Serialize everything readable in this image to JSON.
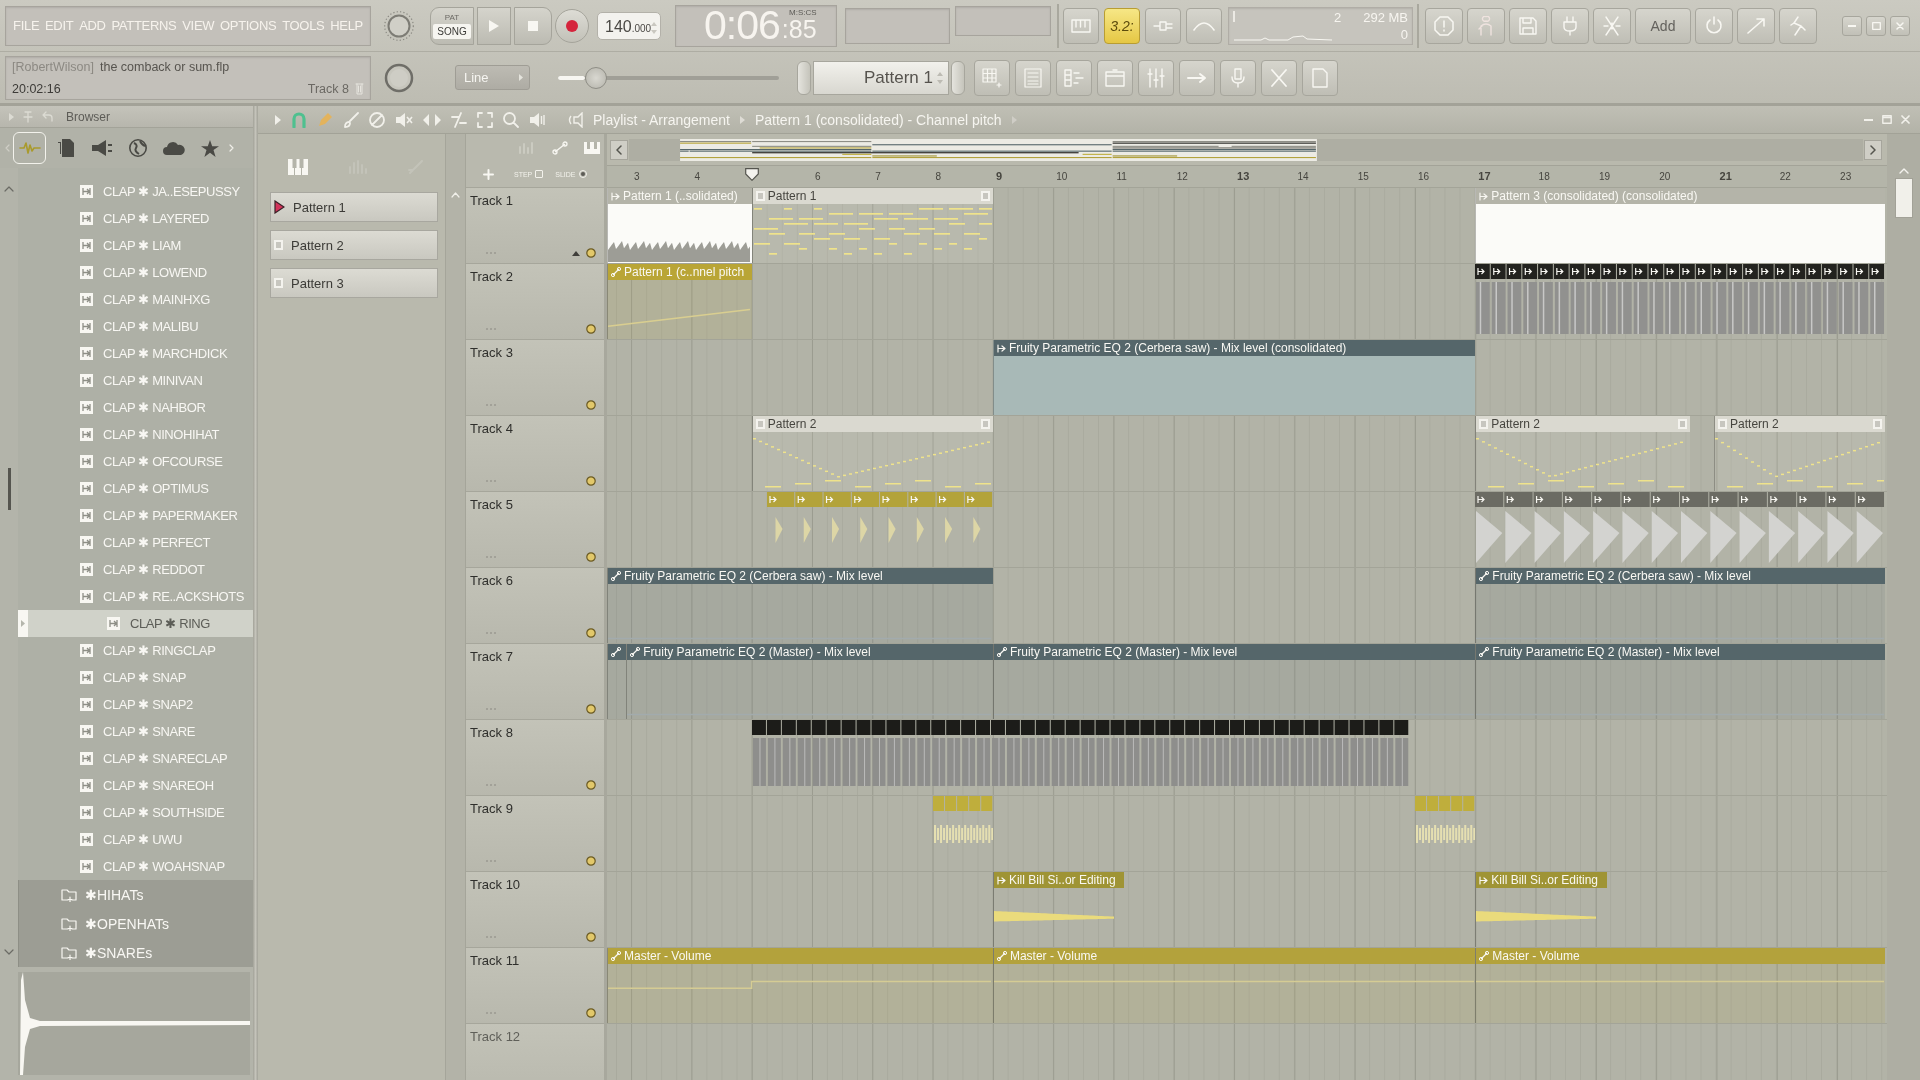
{
  "menu": [
    "FILE",
    "EDIT",
    "ADD",
    "PATTERNS",
    "VIEW",
    "OPTIONS",
    "TOOLS",
    "HELP"
  ],
  "transport": {
    "pattern_label": "PAT",
    "song_label": "SONG",
    "song_mode": true,
    "tempo": "140",
    "tempo_fraction": ".000",
    "time": "0:06",
    "time_fraction": ":85",
    "time_format": "M:S:CS"
  },
  "toolbar": {
    "typing_keyboard": {
      "label": "3.2:",
      "on": true
    },
    "cpu": "2",
    "memory": "292 MB",
    "polyphony": "0",
    "add_label": "Add"
  },
  "project": {
    "user": "[RobertWilson]",
    "file": "the comback or sum.flp",
    "clock": "20:02:16",
    "hint": "Track 8"
  },
  "snap": {
    "value": "Line"
  },
  "slider": {
    "level": 0.17
  },
  "pattern_selector": {
    "value": "Pattern 1"
  },
  "browser": {
    "title": "Browser",
    "tabs": [
      {
        "selected": true
      },
      {
        "selected": false
      },
      {
        "selected": false
      },
      {
        "selected": false
      },
      {
        "selected": false
      },
      {
        "selected": false
      }
    ],
    "items": [
      {
        "label": "CLAP ✱ JA..ESEPUSSY",
        "selected": false
      },
      {
        "label": "CLAP ✱ LAYERED",
        "selected": false
      },
      {
        "label": "CLAP ✱ LIAM",
        "selected": false
      },
      {
        "label": "CLAP ✱ LOWEND",
        "selected": false
      },
      {
        "label": "CLAP ✱ MAINHXG",
        "selected": false
      },
      {
        "label": "CLAP ✱ MALIBU",
        "selected": false
      },
      {
        "label": "CLAP ✱ MARCHDICK",
        "selected": false
      },
      {
        "label": "CLAP ✱ MINIVAN",
        "selected": false
      },
      {
        "label": "CLAP ✱ NAHBOR",
        "selected": false
      },
      {
        "label": "CLAP ✱ NINOHIHAT",
        "selected": false
      },
      {
        "label": "CLAP ✱ OFCOURSE",
        "selected": false
      },
      {
        "label": "CLAP ✱ OPTIMUS",
        "selected": false
      },
      {
        "label": "CLAP ✱ PAPERMAKER",
        "selected": false
      },
      {
        "label": "CLAP ✱ PERFECT",
        "selected": false
      },
      {
        "label": "CLAP ✱ REDDOT",
        "selected": false
      },
      {
        "label": "CLAP ✱ RE..ACKSHOTS",
        "selected": false
      },
      {
        "label": "CLAP ✱ RING",
        "selected": true
      },
      {
        "label": "CLAP ✱ RINGCLAP",
        "selected": false
      },
      {
        "label": "CLAP ✱ SNAP",
        "selected": false
      },
      {
        "label": "CLAP ✱ SNAP2",
        "selected": false
      },
      {
        "label": "CLAP ✱ SNARE",
        "selected": false
      },
      {
        "label": "CLAP ✱ SNARECLAP",
        "selected": false
      },
      {
        "label": "CLAP ✱ SNAREOH",
        "selected": false
      },
      {
        "label": "CLAP ✱ SOUTHSIDE",
        "selected": false
      },
      {
        "label": "CLAP ✱ UWU",
        "selected": false
      },
      {
        "label": "CLAP ✱ WOAHSNAP",
        "selected": false
      }
    ],
    "folders": [
      {
        "label": "✱HIHATs"
      },
      {
        "label": "✱OPENHATs"
      },
      {
        "label": "✱SNAREs"
      }
    ]
  },
  "patterns": [
    {
      "label": "Pattern 1",
      "selected": true
    },
    {
      "label": "Pattern 2",
      "selected": false
    },
    {
      "label": "Pattern 3",
      "selected": false
    }
  ],
  "playlist": {
    "title": "Playlist - Arrangement",
    "breadcrumb": "Pattern 1 (consolidated) - Channel pitch",
    "step": {
      "label": "STEP",
      "checked": false
    },
    "slide": {
      "label": "SLIDE",
      "checked": true
    },
    "ruler": [
      "3",
      "4",
      "6",
      "7",
      "8",
      "9",
      "10",
      "11",
      "12",
      "13",
      "14",
      "15",
      "16",
      "17",
      "18",
      "19",
      "20",
      "21",
      "22",
      "23"
    ],
    "tracks": [
      {
        "name": "Track 1",
        "dimmed": false,
        "clips": [
          {
            "kind": "audio",
            "label": "Pattern 1 (..solidated)",
            "color": "#b4b4a9"
          },
          {
            "kind": "pattern",
            "label": "Pattern 1",
            "color": "#dad9d0"
          },
          {
            "kind": "audio",
            "label": "Pattern 3 (consolidated) (consolidated)",
            "color": "#b4b4a9"
          }
        ]
      },
      {
        "name": "Track 2",
        "dimmed": false,
        "clips": [
          {
            "kind": "automation",
            "label": "Pattern 1 (c..nnel pitch",
            "color": "#b9a536"
          },
          {
            "kind": "slices",
            "color": "#23231f"
          }
        ]
      },
      {
        "name": "Track 3",
        "dimmed": false,
        "clips": [
          {
            "kind": "audio",
            "label": "Fruity Parametric EQ 2 (Cerbera saw) - Mix level (consolidated)",
            "color": "#55666a"
          }
        ]
      },
      {
        "name": "Track 4",
        "dimmed": false,
        "clips": [
          {
            "kind": "pattern",
            "label": "Pattern 2",
            "color": "#dad9d0"
          },
          {
            "kind": "pattern",
            "label": "Pattern 2",
            "color": "#dad9d0"
          },
          {
            "kind": "pattern",
            "label": "Pattern 2",
            "color": "#dad9d0"
          }
        ]
      },
      {
        "name": "Track 5",
        "dimmed": false,
        "clips": [
          {
            "kind": "slices",
            "color": "#b3a33a"
          },
          {
            "kind": "slices",
            "color": "#6b6b63"
          }
        ]
      },
      {
        "name": "Track 6",
        "dimmed": false,
        "clips": [
          {
            "kind": "automation",
            "label": "Fruity Parametric EQ 2 (Cerbera saw) - Mix level",
            "color": "#55666a"
          },
          {
            "kind": "automation",
            "label": "Fruity Parametric EQ 2 (Cerbera saw) - Mix level",
            "color": "#55666a"
          }
        ]
      },
      {
        "name": "Track 7",
        "dimmed": false,
        "clips": [
          {
            "kind": "automation",
            "color": "#55666a"
          },
          {
            "kind": "automation",
            "label": "Fruity Parametric EQ 2 (Master) - Mix level",
            "color": "#55666a"
          },
          {
            "kind": "automation",
            "label": "Fruity Parametric EQ 2 (Master) - Mix level",
            "color": "#55666a"
          },
          {
            "kind": "automation",
            "label": "Fruity Parametric EQ 2 (Master) - Mix level",
            "color": "#55666a"
          }
        ]
      },
      {
        "name": "Track 8",
        "dimmed": false,
        "clips": [
          {
            "kind": "slices",
            "color": "#1c1c19"
          }
        ]
      },
      {
        "name": "Track 9",
        "dimmed": false,
        "clips": [
          {
            "kind": "slices",
            "color": "#bfae3c"
          },
          {
            "kind": "slices",
            "color": "#bfae3c"
          }
        ]
      },
      {
        "name": "Track 10",
        "dimmed": false,
        "clips": [
          {
            "kind": "audio",
            "label": "Kill Bill Si..or Editing",
            "color": "#9f9435"
          },
          {
            "kind": "audio",
            "label": "Kill Bill Si..or Editing",
            "color": "#9f9435"
          }
        ]
      },
      {
        "name": "Track 11",
        "dimmed": false,
        "clips": [
          {
            "kind": "automation",
            "label": "Master - Volume",
            "color": "#b3a23c"
          },
          {
            "kind": "automation",
            "label": "Master - Volume",
            "color": "#b3a23c"
          },
          {
            "kind": "automation",
            "label": "Master - Volume",
            "color": "#b3a23c"
          }
        ]
      },
      {
        "name": "Track 12",
        "dimmed": true
      }
    ]
  }
}
